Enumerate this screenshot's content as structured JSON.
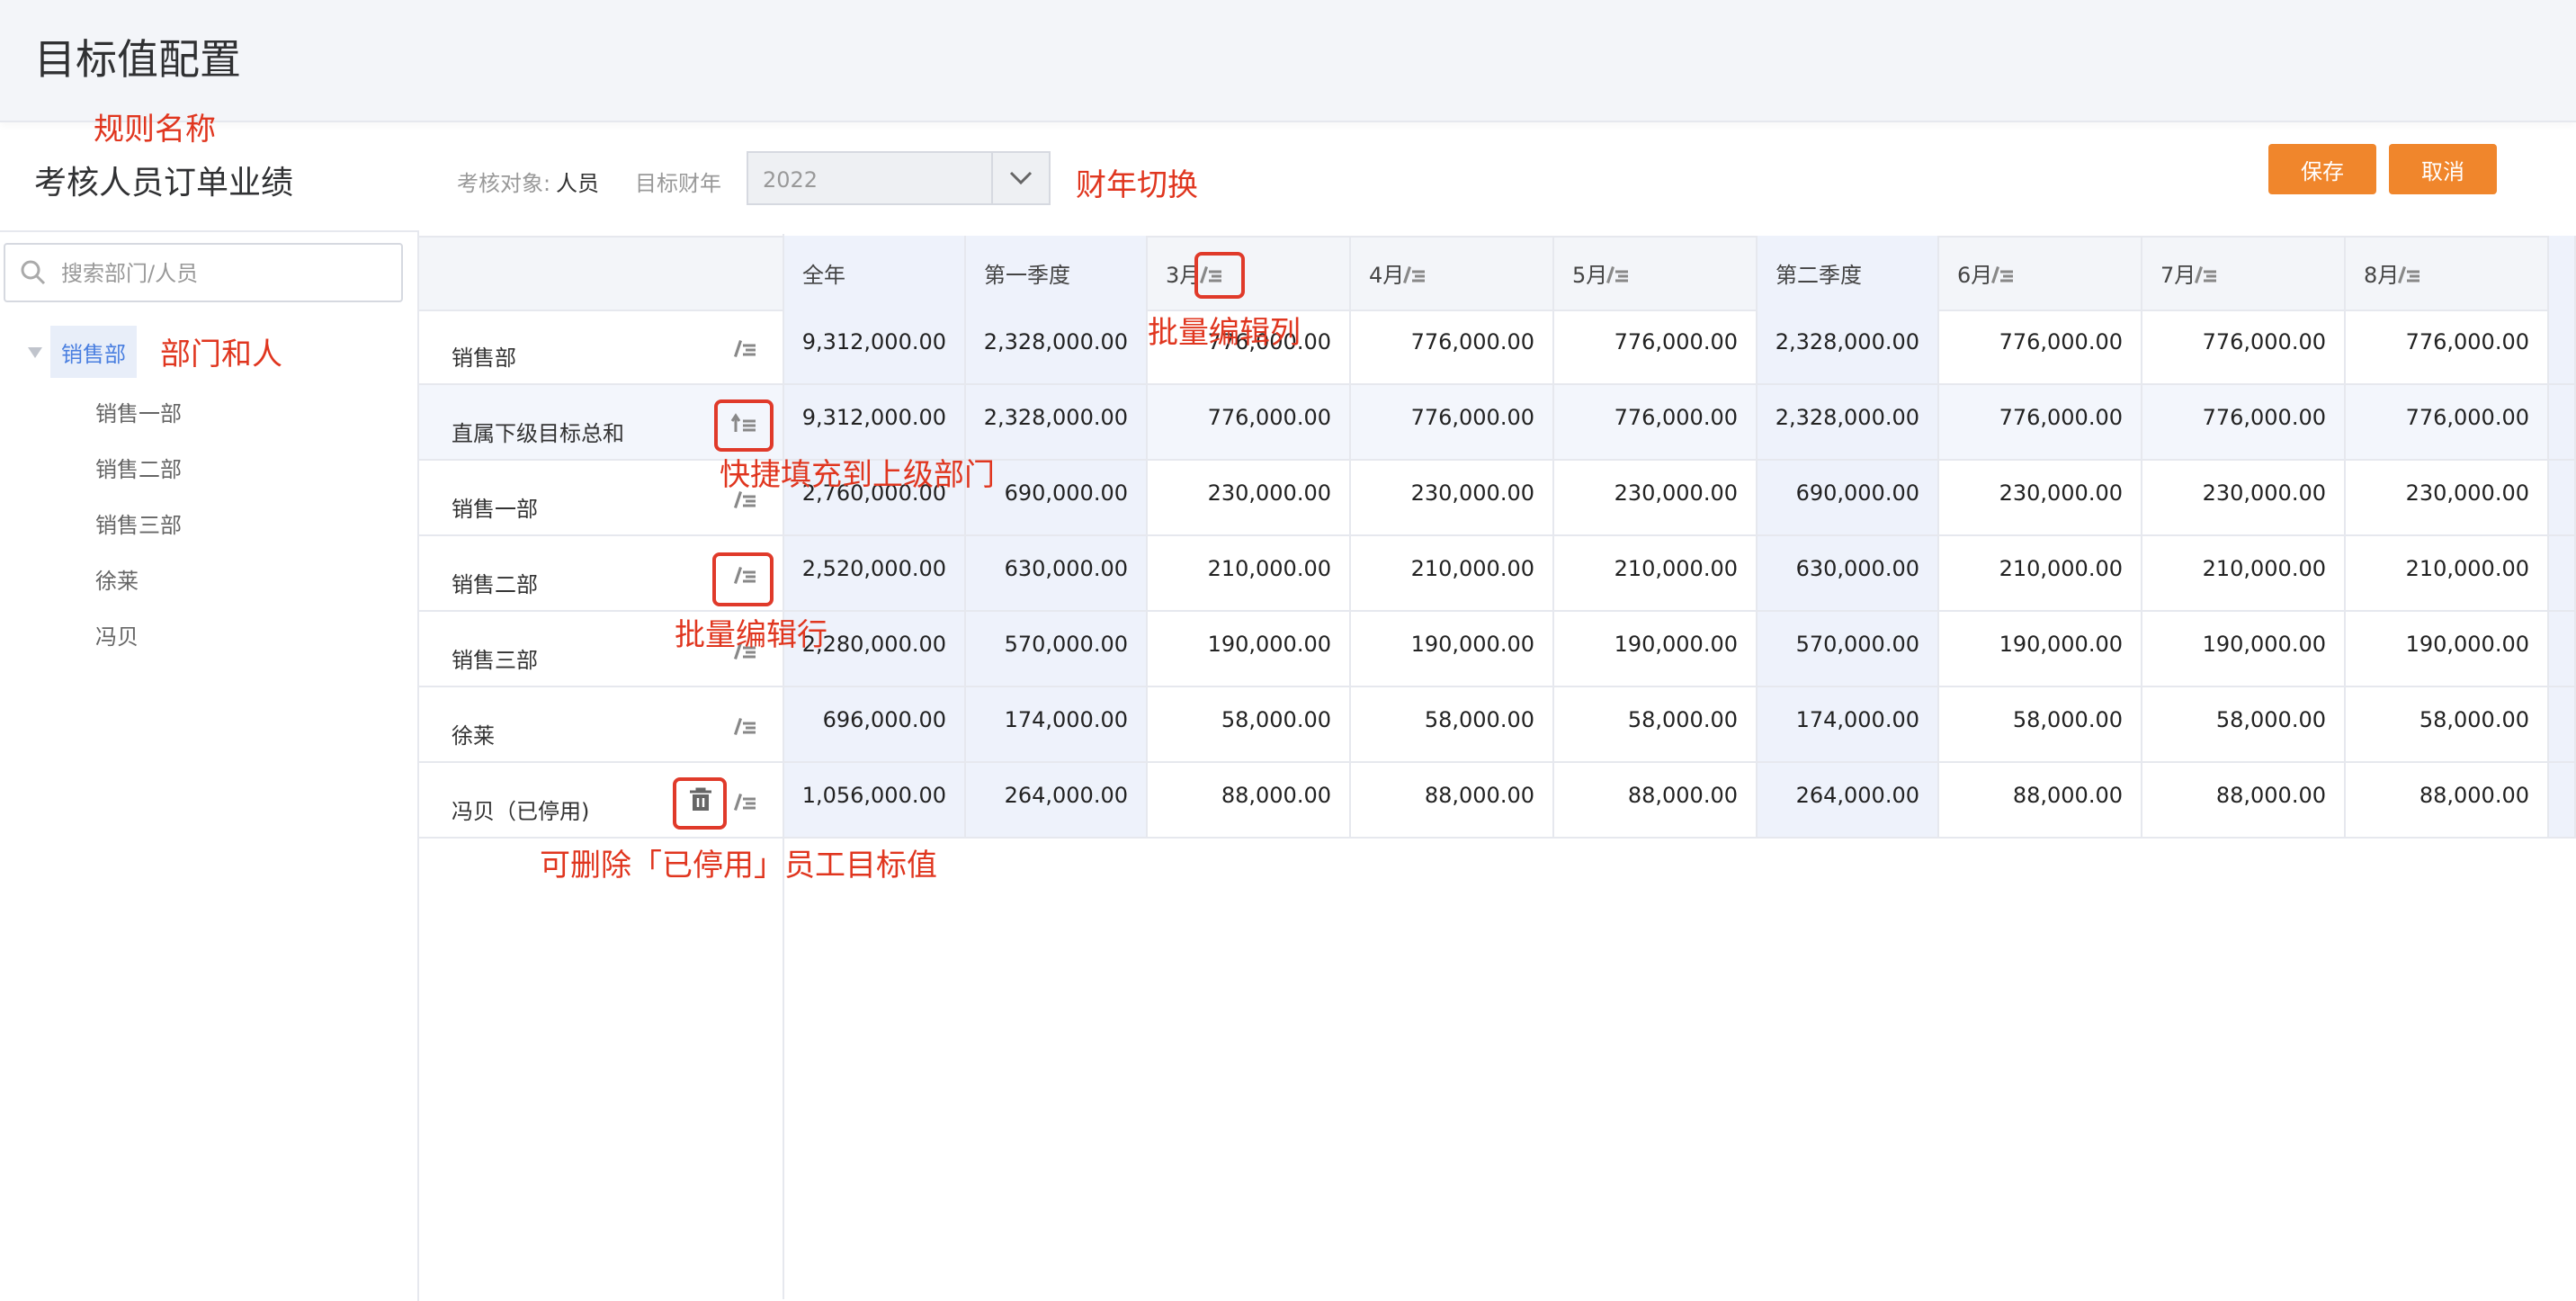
{
  "page": {
    "title": "目标值配置"
  },
  "rule": {
    "name": "考核人员订单业绩"
  },
  "filters": {
    "target_label": "考核对象:",
    "target_value": "人员",
    "year_label": "目标财年",
    "year_value": "2022"
  },
  "actions": {
    "save": "保存",
    "cancel": "取消"
  },
  "search": {
    "placeholder": "搜索部门/人员"
  },
  "tree": {
    "root": "销售部",
    "children": [
      "销售一部",
      "销售二部",
      "销售三部",
      "徐莱",
      "冯贝"
    ]
  },
  "table": {
    "columns": [
      "全年",
      "第一季度",
      "3月",
      "4月",
      "5月",
      "第二季度",
      "6月",
      "7月",
      "8月"
    ],
    "rows": [
      {
        "name": "销售部",
        "values": [
          "9,312,000.00",
          "2,328,000.00",
          "776,000.00",
          "776,000.00",
          "776,000.00",
          "2,328,000.00",
          "776,000.00",
          "776,000.00",
          "776,000.00"
        ]
      },
      {
        "name": "直属下级目标总和",
        "values": [
          "9,312,000.00",
          "2,328,000.00",
          "776,000.00",
          "776,000.00",
          "776,000.00",
          "2,328,000.00",
          "776,000.00",
          "776,000.00",
          "776,000.00"
        ]
      },
      {
        "name": "销售一部",
        "values": [
          "2,760,000.00",
          "690,000.00",
          "230,000.00",
          "230,000.00",
          "230,000.00",
          "690,000.00",
          "230,000.00",
          "230,000.00",
          "230,000.00"
        ]
      },
      {
        "name": "销售二部",
        "values": [
          "2,520,000.00",
          "630,000.00",
          "210,000.00",
          "210,000.00",
          "210,000.00",
          "630,000.00",
          "210,000.00",
          "210,000.00",
          "210,000.00"
        ]
      },
      {
        "name": "销售三部",
        "values": [
          "2,280,000.00",
          "570,000.00",
          "190,000.00",
          "190,000.00",
          "190,000.00",
          "570,000.00",
          "190,000.00",
          "190,000.00",
          "190,000.00"
        ]
      },
      {
        "name": "徐莱",
        "values": [
          "696,000.00",
          "174,000.00",
          "58,000.00",
          "58,000.00",
          "58,000.00",
          "174,000.00",
          "58,000.00",
          "58,000.00",
          "58,000.00"
        ]
      },
      {
        "name": "冯贝（已停用)",
        "values": [
          "1,056,000.00",
          "264,000.00",
          "88,000.00",
          "88,000.00",
          "88,000.00",
          "264,000.00",
          "88,000.00",
          "88,000.00",
          "88,000.00"
        ]
      }
    ]
  },
  "annotations": {
    "rule_name": "规则名称",
    "year_switch": "财年切换",
    "dept_people": "部门和人",
    "batch_col": "批量编辑列",
    "quick_fill": "快捷填充到上级部门",
    "batch_row": "批量编辑行",
    "delete_disabled": "可删除「已停用」员工目标值"
  },
  "colors": {
    "accent": "#f0862c",
    "annotation": "#e0361f",
    "quarter_bg": "#eef2fb",
    "selected": "#4a7fe0"
  },
  "icons": [
    "edit-list-icon",
    "fill-up-icon",
    "trash-icon",
    "search-icon",
    "chevron-down-icon",
    "caret-down-icon"
  ]
}
